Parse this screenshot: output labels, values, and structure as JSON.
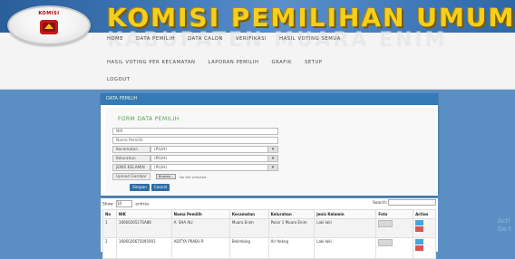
{
  "header": {
    "logo_text": "KOMISI",
    "title": "KOMISI PEMILIHAN UMUM",
    "subtitle": "KABUPATEN MUARA ENIM"
  },
  "nav": {
    "row1": [
      "HOME",
      "DATA PEMILIH",
      "DATA CALON",
      "VERIFIKASI",
      "HASIL VOTING SEMUA"
    ],
    "row2": [
      "HASIL VOTING PER KECAMATAN",
      "LAPORAN PEMILIH",
      "GRAFIK",
      "SETUP"
    ],
    "row3": [
      "LOGOUT"
    ]
  },
  "form_card": {
    "header": "DATA PEMILIH",
    "title": "FORM DATA PEMILIH",
    "nik_placeholder": "NIK",
    "nama_placeholder": "Nama Pemilih",
    "kecamatan_label": "Kecamatan",
    "kecamatan_value": "(PILIH)",
    "kelurahan_label": "Kelurahan",
    "kelurahan_value": "(PILIH)",
    "jenis_kelamin_label": "JENIS KELAMIN",
    "jenis_kelamin_value": "(PILIH)",
    "upload_label": "Upload Gambar",
    "browse_label": "Browse...",
    "file_status": "No file selected.",
    "save_label": "Simpan",
    "cancel_label": "Cancel"
  },
  "table_card": {
    "show_label": "Show",
    "show_value": "10",
    "entries_label": "entries",
    "search_label": "Search:",
    "columns": [
      "No",
      "NIK",
      "Nama Pemilih",
      "Kecamatan",
      "Kelurahan",
      "Jenis Kelamin",
      "Foto",
      "Action"
    ],
    "rows": [
      [
        "1",
        "1606026517SA86",
        "A. SHA ALI",
        "Muara Enim",
        "Pasar 1 Muara Enim",
        "Laki-laki"
      ],
      [
        "2",
        "1606026675095001",
        "ADITYA PRABU R",
        "Belimbing",
        "Air Itekng",
        "Laki-laki"
      ]
    ]
  },
  "watermark": [
    "Acti",
    "Go t"
  ]
}
